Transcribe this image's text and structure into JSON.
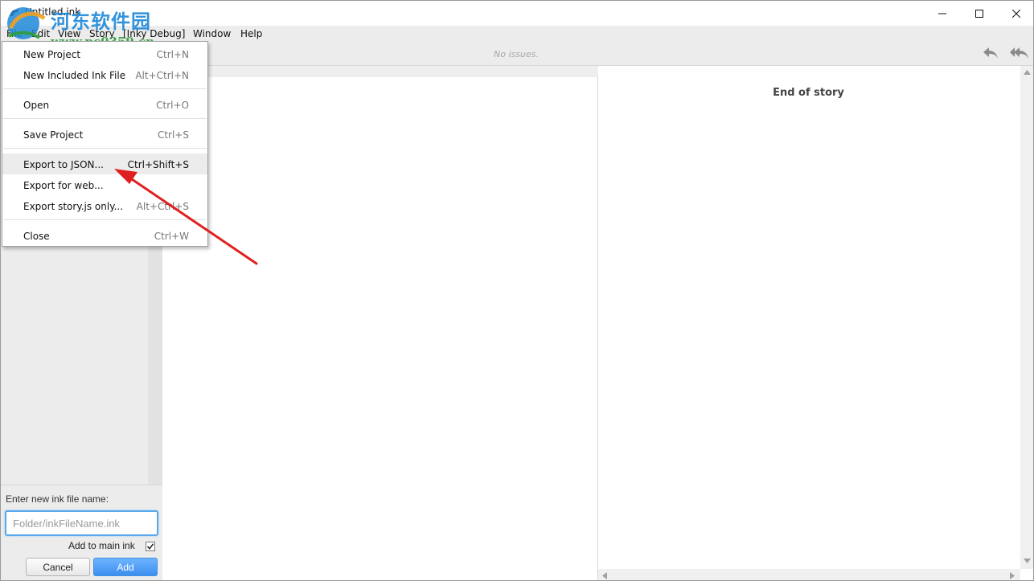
{
  "window": {
    "title": "Untitled.ink"
  },
  "watermark": {
    "cn": "河东软件园",
    "url": "www.pc0359.cn"
  },
  "menubar": {
    "items": [
      "File",
      "Edit",
      "View",
      "Story",
      "[Inky Debug]",
      "Window",
      "Help"
    ]
  },
  "toolbar": {
    "issues": "No issues."
  },
  "file_menu": {
    "items": [
      {
        "label": "New Project",
        "shortcut": "Ctrl+N"
      },
      {
        "label": "New Included Ink File",
        "shortcut": "Alt+Ctrl+N"
      },
      {
        "label": "Open",
        "shortcut": "Ctrl+O"
      },
      {
        "label": "Save Project",
        "shortcut": "Ctrl+S"
      },
      {
        "label": "Export to JSON...",
        "shortcut": "Ctrl+Shift+S"
      },
      {
        "label": "Export for web...",
        "shortcut": ""
      },
      {
        "label": "Export story.js only...",
        "shortcut": "Alt+Ctrl+S"
      },
      {
        "label": "Close",
        "shortcut": "Ctrl+W"
      }
    ],
    "highlighted": "Export to JSON..."
  },
  "new_file": {
    "label": "Enter new ink file name:",
    "placeholder": "Folder/inkFileName.ink",
    "add_to_main": "Add to main ink",
    "add_to_main_checked": true,
    "cancel": "Cancel",
    "add": "Add"
  },
  "player": {
    "end_text": "End of story"
  },
  "colors": {
    "accent_blue": "#3d8ef0",
    "annotation_red": "#e02020",
    "chrome_gray": "#ececec"
  }
}
